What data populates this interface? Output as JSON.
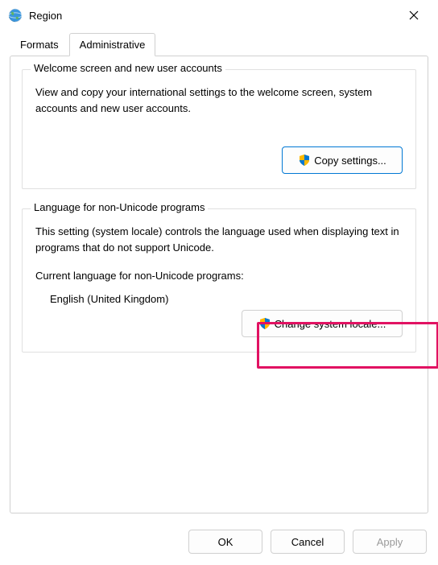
{
  "window": {
    "title": "Region"
  },
  "tabs": {
    "formats": "Formats",
    "administrative": "Administrative"
  },
  "group1": {
    "legend": "Welcome screen and new user accounts",
    "desc": "View and copy your international settings to the welcome screen, system accounts and new user accounts.",
    "copy_btn": "Copy settings..."
  },
  "group2": {
    "legend": "Language for non-Unicode programs",
    "desc": "This setting (system locale) controls the language used when displaying text in programs that do not support Unicode.",
    "cur_label": "Current language for non-Unicode programs:",
    "cur_value": "English (United Kingdom)",
    "change_btn": "Change system locale..."
  },
  "footer": {
    "ok": "OK",
    "cancel": "Cancel",
    "apply": "Apply"
  }
}
